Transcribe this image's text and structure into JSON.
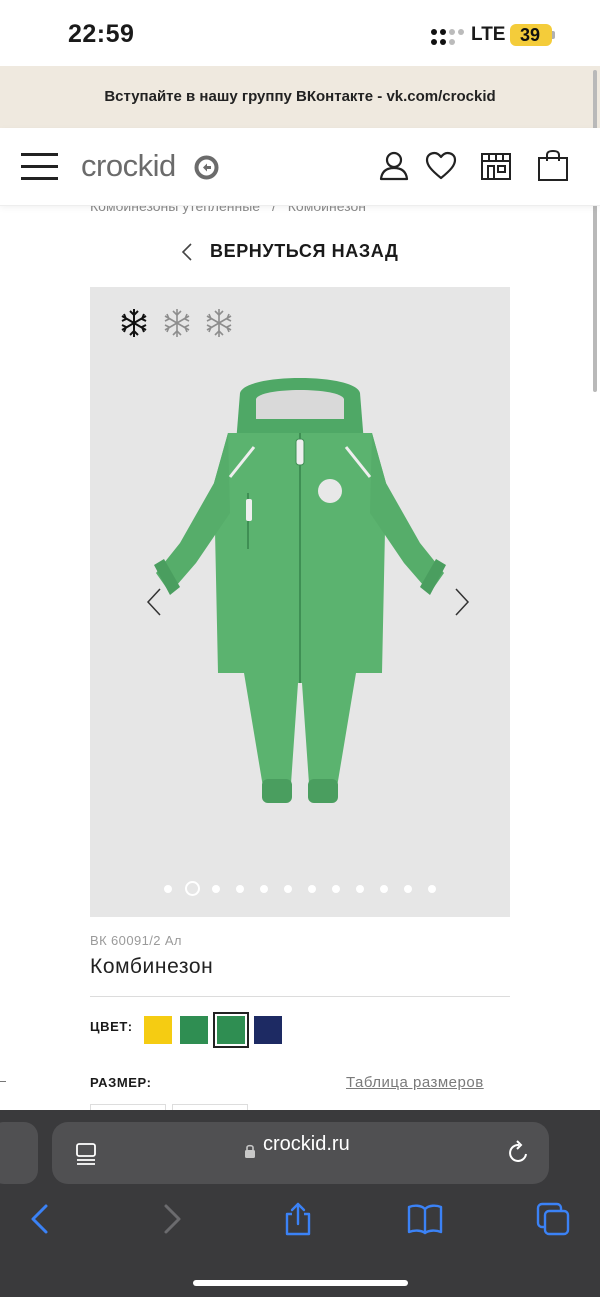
{
  "status_bar": {
    "time": "22:59",
    "network": "LTE",
    "battery": "39",
    "battery_color": "#f4cc3a"
  },
  "promo": {
    "text": "Вступайте в нашу группу ВКонтакте - vk.com/crockid",
    "background": "#efe9df"
  },
  "header": {
    "logo_text": "crockid",
    "icons": [
      "menu-icon",
      "user-icon",
      "heart-icon",
      "store-icon",
      "bag-icon"
    ]
  },
  "breadcrumb": {
    "items": [
      "Комбинезоны утепленные",
      "/",
      "Комбинезон"
    ]
  },
  "back": {
    "label": "ВЕРНУТЬСЯ НАЗАД"
  },
  "gallery": {
    "background": "#e6e6e6",
    "insulation_level": 1,
    "insulation_max": 3,
    "image_count": 12,
    "active_image": 2,
    "product_color": "#5bb36f"
  },
  "product": {
    "sku": "ВК 60091/2 Ал",
    "name": "Комбинезон",
    "color_label": "ЦВЕТ:",
    "colors": [
      "#f5cc12",
      "#2f8e52",
      "#2f8e52",
      "#1d2a63"
    ],
    "selected_color_index": 2,
    "size_label": "РАЗМЕР:",
    "size_table_link": "Таблица размеров"
  },
  "browser": {
    "url": "crockid.ru",
    "background": "#3a3a3c",
    "accent": "#3b82f6",
    "icons": [
      "tabs-overview-icon",
      "lock-icon",
      "reload-icon",
      "back-icon",
      "forward-icon",
      "share-icon",
      "bookmarks-icon",
      "tabs-icon"
    ]
  }
}
